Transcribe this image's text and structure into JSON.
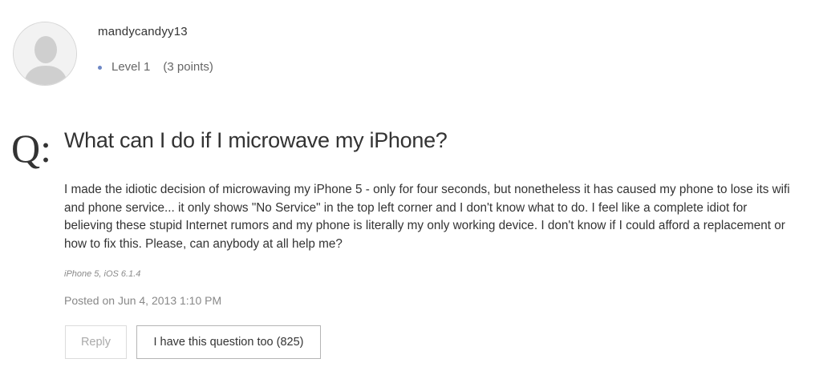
{
  "author": {
    "username": "mandycandyy13",
    "level": "Level 1",
    "points": "(3 points)",
    "avatar_icon": "default-user-silhouette-icon"
  },
  "question": {
    "q_label": "Q:",
    "title": "What can I do if I microwave my iPhone?",
    "body": "I made the idiotic decision of microwaving my iPhone 5 - only for four seconds, but nonetheless it has caused my phone to lose its wifi and phone service... it only shows \"No Service\" in the top left corner and I don't know what to do. I feel like a complete idiot for believing these stupid Internet rumors and my phone is literally my only working device. I don't know if I could afford a replacement or how to fix this. Please, can anybody at all help me?",
    "device": "iPhone 5, iOS 6.1.4",
    "posted": "Posted on Jun 4, 2013 1:10 PM"
  },
  "actions": {
    "reply_label": "Reply",
    "same_question_label": "I have this question too (825)"
  },
  "colors": {
    "level_dot": "#6d87c5",
    "text": "#333333",
    "muted": "#888888"
  }
}
